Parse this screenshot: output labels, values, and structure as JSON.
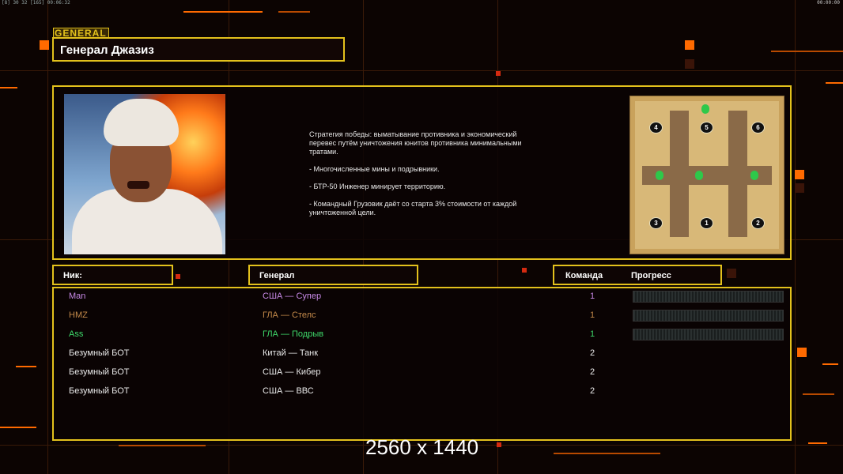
{
  "topbar": {
    "left_text": "[8] 30 32 [165] 00:06:32",
    "right_text": "00:00:00"
  },
  "general_tag": "GENERAL",
  "general_name": "Генерал Джазиз",
  "strategy": {
    "paragraphs": [
      "Стратегия победы: выматывание противника и экономический\n перевес путём уничтожения юнитов противника минимальными\n тратами.",
      "- Многочисленные мины и подрывники.",
      "- БТР-50 Инженер минирует территорию.",
      "- Командный Грузовик даёт со старта 3% стоимости от каждой\n уничтоженной цели."
    ]
  },
  "minimap": {
    "slots": [
      "4",
      "5",
      "6",
      "3",
      "1",
      "2"
    ]
  },
  "headers": {
    "nick": "Ник:",
    "general": "Генерал",
    "team": "Команда",
    "progress": "Прогресс"
  },
  "players": [
    {
      "nick": "Man",
      "general": "США — Супер",
      "team": "1",
      "color": "#c88ae8",
      "has_progress": true
    },
    {
      "nick": "HMZ",
      "general": "ГЛА — Стелс",
      "team": "1",
      "color": "#c48a4a",
      "has_progress": true
    },
    {
      "nick": "Ass",
      "general": "ГЛА — Подрыв",
      "team": "1",
      "color": "#3ed96a",
      "has_progress": true
    },
    {
      "nick": "Безумный БОТ",
      "general": "Китай — Танк",
      "team": "2",
      "color": "#e8e8e8",
      "has_progress": false
    },
    {
      "nick": "Безумный БОТ",
      "general": "США — Кибер",
      "team": "2",
      "color": "#e8e8e8",
      "has_progress": false
    },
    {
      "nick": "Безумный БОТ",
      "general": "США — ВВС",
      "team": "2",
      "color": "#e8e8e8",
      "has_progress": false
    }
  ],
  "watermark": "2560 x 1440",
  "colors": {
    "accent_gold": "#e3c11c",
    "accent_orange": "#ff6a00",
    "background": "#0c0402"
  }
}
